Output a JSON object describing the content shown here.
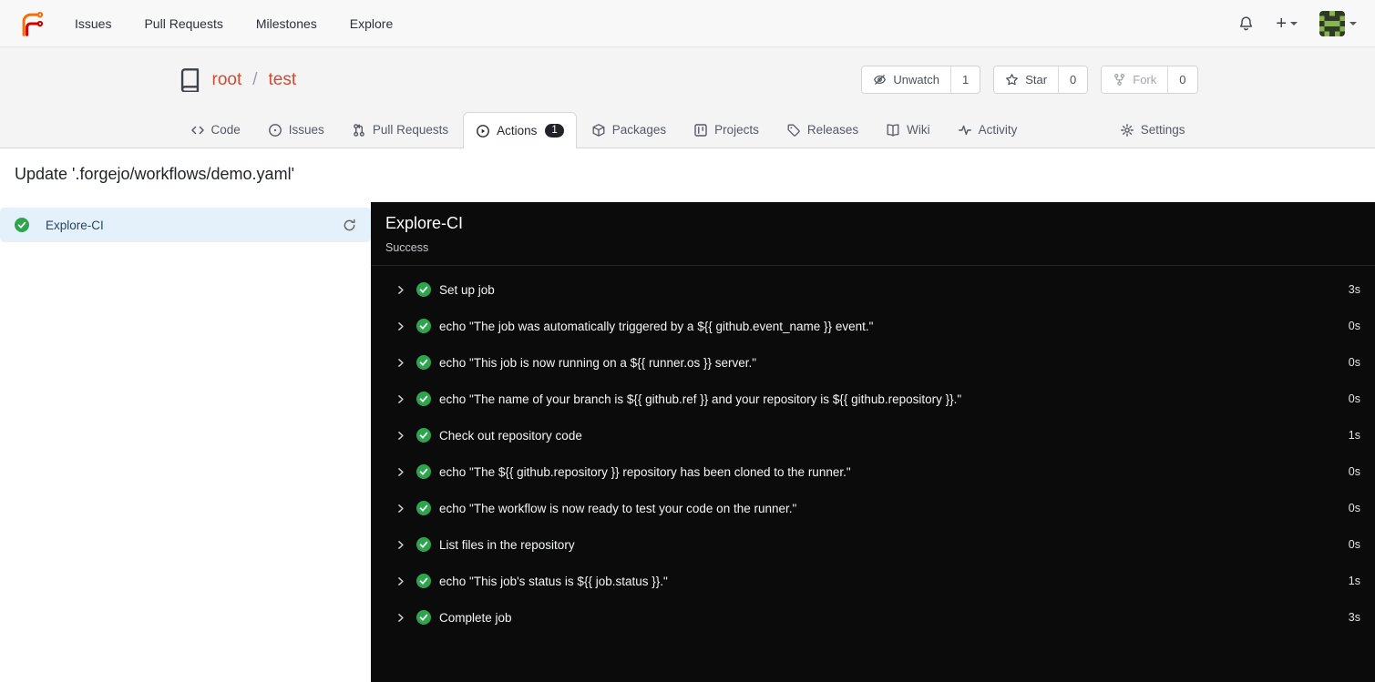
{
  "colors": {
    "brand_orange": "#ff6b00",
    "brand_red": "#d40000",
    "breadcrumb_link": "#cf4b33",
    "success_green": "#2ea44f",
    "selected_job_bg": "#e4f1fb",
    "log_panel_bg": "#0b0b0b",
    "actions_badge_bg": "#212327"
  },
  "navbar": {
    "items": [
      {
        "label": "Issues"
      },
      {
        "label": "Pull Requests"
      },
      {
        "label": "Milestones"
      },
      {
        "label": "Explore"
      }
    ],
    "plus_label": "+"
  },
  "repo_header": {
    "owner": "root",
    "separator": "/",
    "name": "test",
    "watch": {
      "label": "Unwatch",
      "count": "1"
    },
    "star": {
      "label": "Star",
      "count": "0"
    },
    "fork": {
      "label": "Fork",
      "count": "0"
    }
  },
  "tabs": [
    {
      "label": "Code"
    },
    {
      "label": "Issues"
    },
    {
      "label": "Pull Requests"
    },
    {
      "label": "Actions",
      "badge": "1"
    },
    {
      "label": "Packages"
    },
    {
      "label": "Projects"
    },
    {
      "label": "Releases"
    },
    {
      "label": "Wiki"
    },
    {
      "label": "Activity"
    },
    {
      "label": "Settings"
    }
  ],
  "run": {
    "title": "Update '.forgejo/workflows/demo.yaml'",
    "job_name": "Explore-CI",
    "status": "Success"
  },
  "steps": [
    {
      "name": "Set up job",
      "duration": "3s"
    },
    {
      "name": "echo \"The job was automatically triggered by a ${{ github.event_name }} event.\"",
      "duration": "0s"
    },
    {
      "name": "echo \"This job is now running on a ${{ runner.os }} server.\"",
      "duration": "0s"
    },
    {
      "name": "echo \"The name of your branch is ${{ github.ref }} and your repository is ${{ github.repository }}.\"",
      "duration": "0s"
    },
    {
      "name": "Check out repository code",
      "duration": "1s"
    },
    {
      "name": "echo \"The ${{ github.repository }} repository has been cloned to the runner.\"",
      "duration": "0s"
    },
    {
      "name": "echo \"The workflow is now ready to test your code on the runner.\"",
      "duration": "0s"
    },
    {
      "name": "List files in the repository",
      "duration": "0s"
    },
    {
      "name": "echo \"This job's status is ${{ job.status }}.\"",
      "duration": "1s"
    },
    {
      "name": "Complete job",
      "duration": "3s"
    }
  ]
}
